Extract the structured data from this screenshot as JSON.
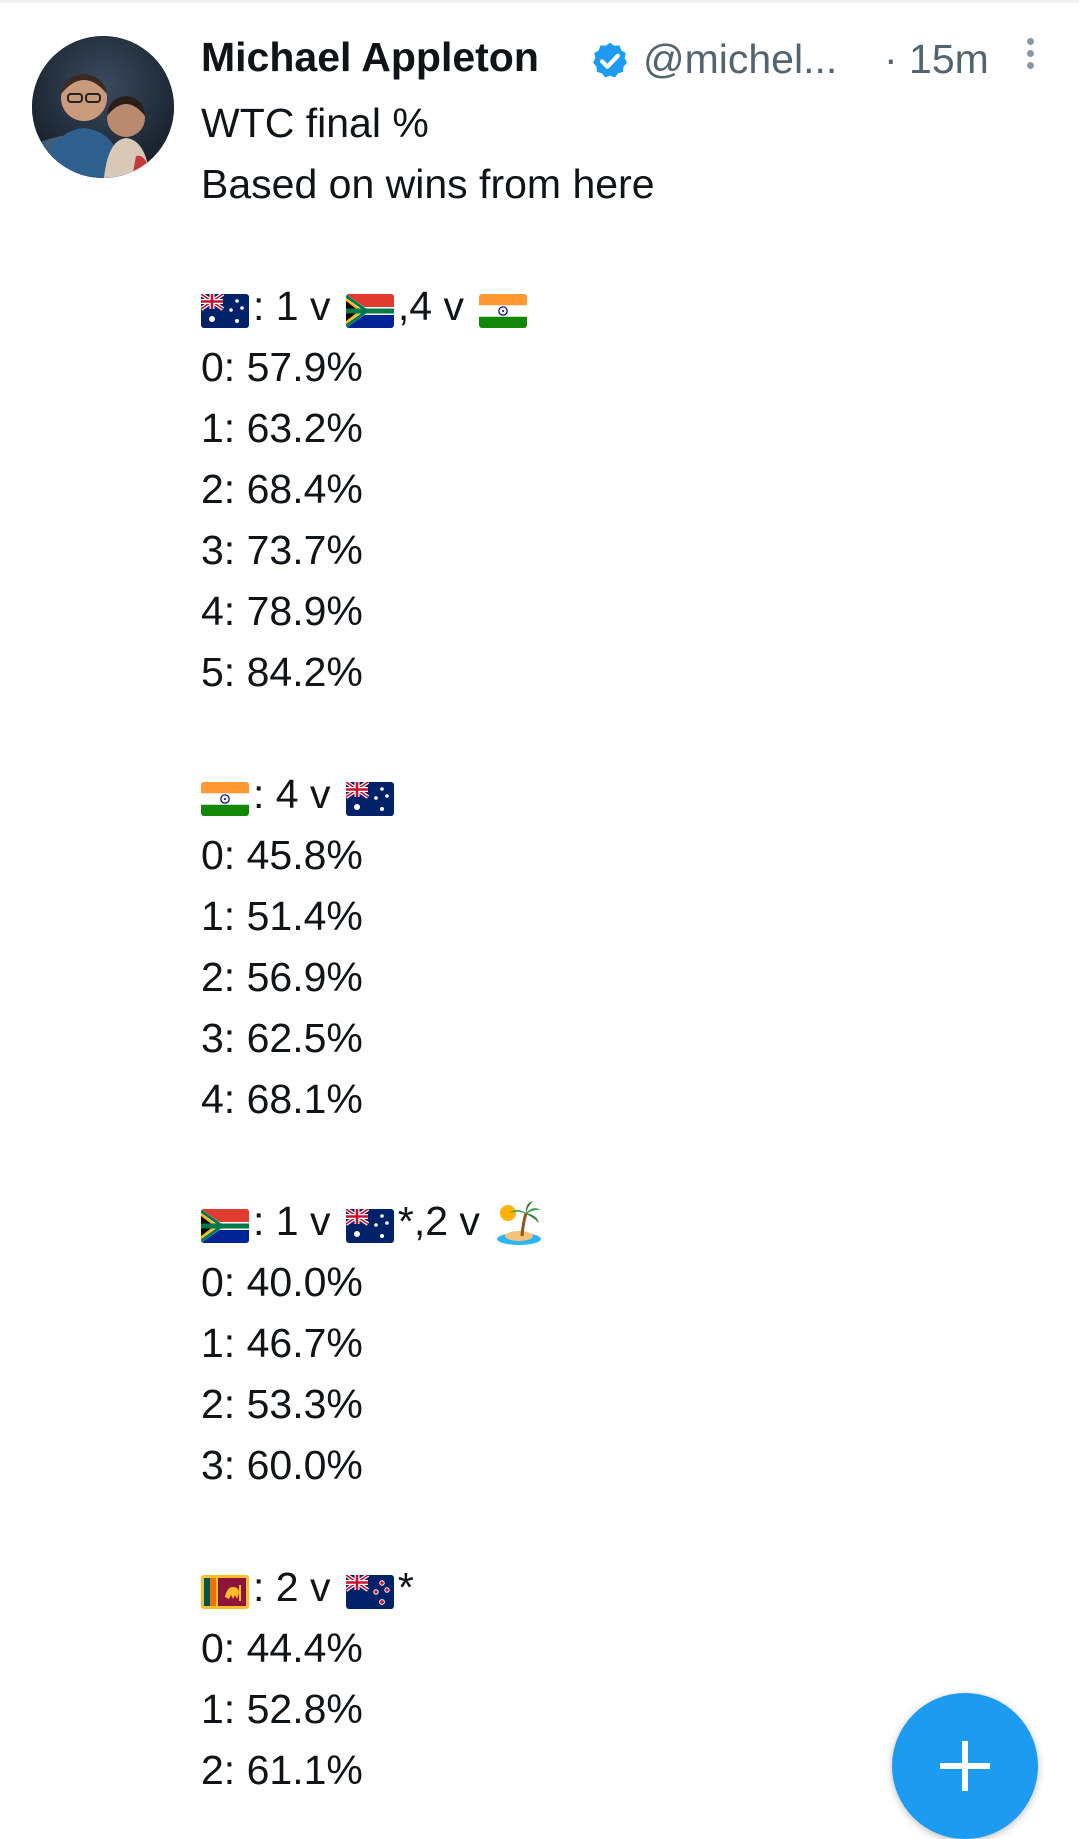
{
  "tweet": {
    "author_name": "Michael Appleton",
    "handle": "@michel...",
    "time": "· 15m",
    "line1": "WTC final %",
    "line2": "Based on wins from here",
    "sections": [
      {
        "header": [
          {
            "flag": "australia-flag-icon"
          },
          {
            "text": ": 1 v "
          },
          {
            "flag": "south-africa-flag-icon"
          },
          {
            "text": ",4 v "
          },
          {
            "flag": "india-flag-icon"
          }
        ],
        "rows": [
          "0: 57.9%",
          "1: 63.2%",
          "2: 68.4%",
          "3: 73.7%",
          "4: 78.9%",
          "5: 84.2%"
        ]
      },
      {
        "header": [
          {
            "flag": "india-flag-icon"
          },
          {
            "text": ": 4 v "
          },
          {
            "flag": "australia-flag-icon"
          }
        ],
        "rows": [
          "0: 45.8%",
          "1: 51.4%",
          "2: 56.9%",
          "3: 62.5%",
          "4: 68.1%"
        ]
      },
      {
        "header": [
          {
            "flag": "south-africa-flag-icon"
          },
          {
            "text": ": 1 v "
          },
          {
            "flag": "australia-flag-icon"
          },
          {
            "text": "*,2 v "
          },
          {
            "flag": "desert-island-icon"
          }
        ],
        "rows": [
          "0: 40.0%",
          "1: 46.7%",
          "2: 53.3%",
          "3: 60.0%"
        ]
      },
      {
        "header": [
          {
            "flag": "sri-lanka-flag-icon"
          },
          {
            "text": ": 2 v "
          },
          {
            "flag": "new-zealand-flag-icon"
          },
          {
            "text": "*"
          }
        ],
        "rows": [
          "0: 44.4%",
          "1: 52.8%",
          "2: 61.1%"
        ]
      }
    ]
  },
  "fab": {
    "icon": "plus-icon"
  },
  "colors": {
    "accent": "#1d9bf0",
    "muted": "#536471",
    "text": "#0f1419"
  }
}
